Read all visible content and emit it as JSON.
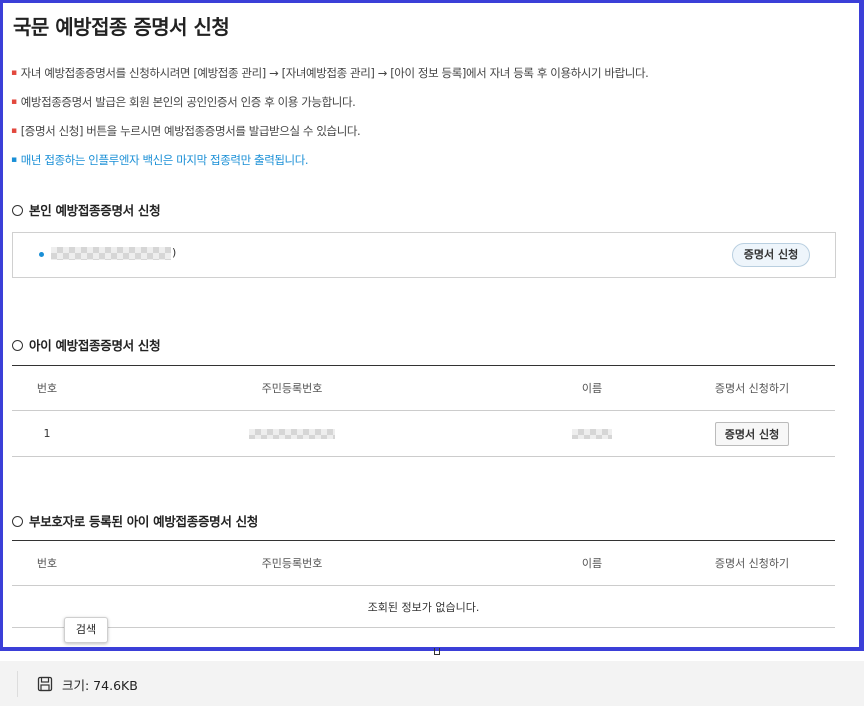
{
  "page": {
    "title": "국문 예방접종 증명서 신청",
    "notes": [
      {
        "text": "자녀 예방접종증명서를 신청하시려면 [예방접종 관리] → [자녀예방접종 관리] → [아이 정보 등록]에서 자녀 등록 후 이용하시기 바랍니다.",
        "highlight": false
      },
      {
        "text": "예방접종증명서 발급은 회원 본인의 공인인증서 인증 후 이용 가능합니다.",
        "highlight": false
      },
      {
        "text": "[증명서 신청] 버튼을 누르시면 예방접종증명서를 발급받으실 수 있습니다.",
        "highlight": false
      },
      {
        "text": "매년 접종하는 인플루엔자 백신은 마지막 접종력만 출력됩니다.",
        "highlight": true
      }
    ]
  },
  "self_section": {
    "title": "본인 예방접종증명서 신청",
    "suffix": ")",
    "button": "증명서 신청"
  },
  "child_section": {
    "title": "아이 예방접종증명서 신청",
    "headers": [
      "번호",
      "주민등록번호",
      "이름",
      "증명서 신청하기"
    ],
    "rows": [
      {
        "no": "1",
        "button": "증명서 신청"
      }
    ]
  },
  "guardian_section": {
    "title": "부보호자로 등록된 아이 예방접종증명서 신청",
    "headers": [
      "번호",
      "주민등록번호",
      "이름",
      "증명서 신청하기"
    ],
    "empty_message": "조회된 정보가 없습니다."
  },
  "tooltip": "검색",
  "status_bar": {
    "icon": "save-icon",
    "size_text": "크기: 74.6KB"
  },
  "colors": {
    "frame_border": "#3b3fd8",
    "highlight_text": "#1a8fd6",
    "bullet_red": "#e2483d"
  }
}
